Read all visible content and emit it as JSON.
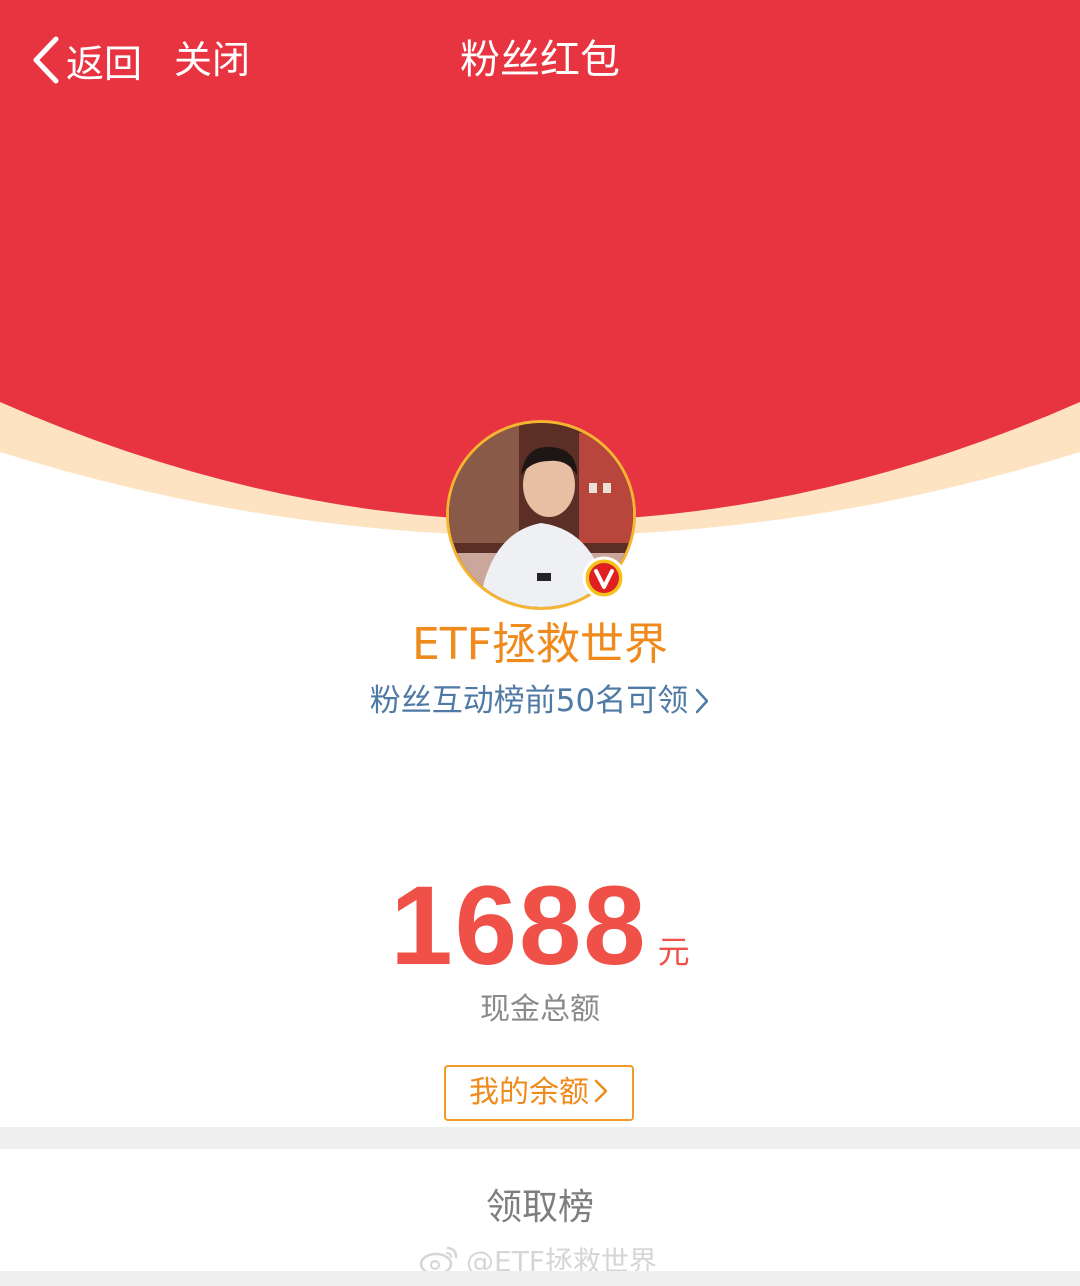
{
  "nav": {
    "back_label": "返回",
    "close_label": "关闭",
    "title": "粉丝红包"
  },
  "profile": {
    "username": "ETF拯救世界",
    "verified": true,
    "rank_link": "粉丝互动榜前50名可领"
  },
  "reward": {
    "amount": "1688",
    "unit": "元",
    "label": "现金总额",
    "balance_button": "我的余额"
  },
  "leaderboard": {
    "title": "领取榜"
  },
  "watermark": {
    "text": "@ETF拯救世界"
  },
  "colors": {
    "header_red": "#e83341",
    "rim_peach": "#fde3c1",
    "name_orange": "#ef8a1c",
    "link_blue": "#4f7aa5",
    "amount_red": "#ef5047"
  },
  "icons": {
    "back": "chevron-left-icon",
    "verified": "verified-v-badge-icon",
    "rank_arrow": "chevron-right-icon",
    "balance_arrow": "chevron-right-icon",
    "watermark_logo": "weibo-logo-icon"
  }
}
